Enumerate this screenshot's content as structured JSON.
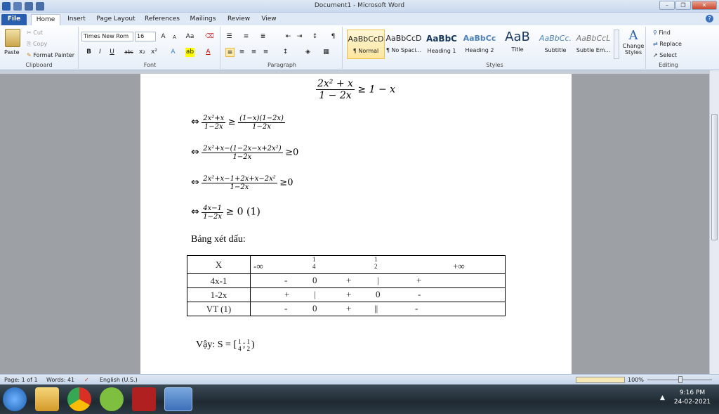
{
  "window": {
    "title": "Document1 - Microsoft Word",
    "tab_hint": ""
  },
  "tabs": [
    {
      "label": "File"
    },
    {
      "label": "Home"
    },
    {
      "label": "Insert"
    },
    {
      "label": "Page Layout"
    },
    {
      "label": "References"
    },
    {
      "label": "Mailings"
    },
    {
      "label": "Review"
    },
    {
      "label": "View"
    }
  ],
  "ribbon": {
    "clipboard": {
      "label": "Clipboard",
      "paste": "Paste",
      "cut": "Cut",
      "copy": "Copy",
      "format_painter": "Format Painter"
    },
    "font": {
      "label": "Font",
      "family": "Times New Rom",
      "size": "16"
    },
    "paragraph": {
      "label": "Paragraph"
    },
    "styles": {
      "label": "Styles",
      "items": [
        {
          "sample": "AaBbCcD",
          "name": "¶ Normal"
        },
        {
          "sample": "AaBbCcD",
          "name": "¶ No Spaci..."
        },
        {
          "sample": "AaBbC",
          "name": "Heading 1"
        },
        {
          "sample": "AaBbCc",
          "name": "Heading 2"
        },
        {
          "sample": "AaB",
          "name": "Title"
        },
        {
          "sample": "AaBbCc.",
          "name": "Subtitle"
        },
        {
          "sample": "AaBbCcL",
          "name": "Subtle Em..."
        }
      ],
      "change_styles": "Change Styles"
    },
    "editing": {
      "label": "Editing",
      "find": "Find",
      "replace": "Replace",
      "select": "Select"
    }
  },
  "document": {
    "top_eq": {
      "num": "2x² + x",
      "den": "1 − 2x",
      "rhs": "≥ 1 − x"
    },
    "steps": [
      {
        "num": "2x²+x",
        "den": "1−2x",
        "rhs_num": "(1−x)(1−2x)",
        "rhs_den": "1−2x",
        "op": "≥"
      },
      {
        "num": "2x²+x−(1−2x−x+2x²)",
        "den": "1−2x",
        "tail": "≥0"
      },
      {
        "num": "2x²+x−1+2x+x−2x²",
        "den": "1−2x",
        "tail": "≥0"
      },
      {
        "num": "4x−1",
        "den": "1−2x",
        "tail": "≥ 0 (1)"
      }
    ],
    "iff": "⇔",
    "heading": "Bảng xét dấu:",
    "table": {
      "header": {
        "label": "X",
        "cells": [
          "-∞",
          "1/4",
          "1/2",
          "+∞"
        ]
      },
      "rows": [
        {
          "label": "4x-1",
          "cells": [
            "-",
            "0",
            "+",
            "|",
            "+"
          ]
        },
        {
          "label": "1-2x",
          "cells": [
            "+",
            "|",
            "+",
            "0",
            "-"
          ]
        },
        {
          "label": "VT (1)",
          "cells": [
            "-",
            "0",
            "+",
            "||",
            "-"
          ]
        }
      ]
    },
    "conclusion": {
      "prefix": "Vậy: S = [",
      "a_num": "1",
      "a_den": "4",
      "sep": ";",
      "b_num": "1",
      "b_den": "2",
      "suffix": ")"
    }
  },
  "status": {
    "page": "Page: 1 of 1",
    "words": "Words: 41",
    "language": "English (U.S.)",
    "zoom": "100%"
  },
  "clock": {
    "time": "9:16 PM",
    "date": "24-02-2021"
  }
}
